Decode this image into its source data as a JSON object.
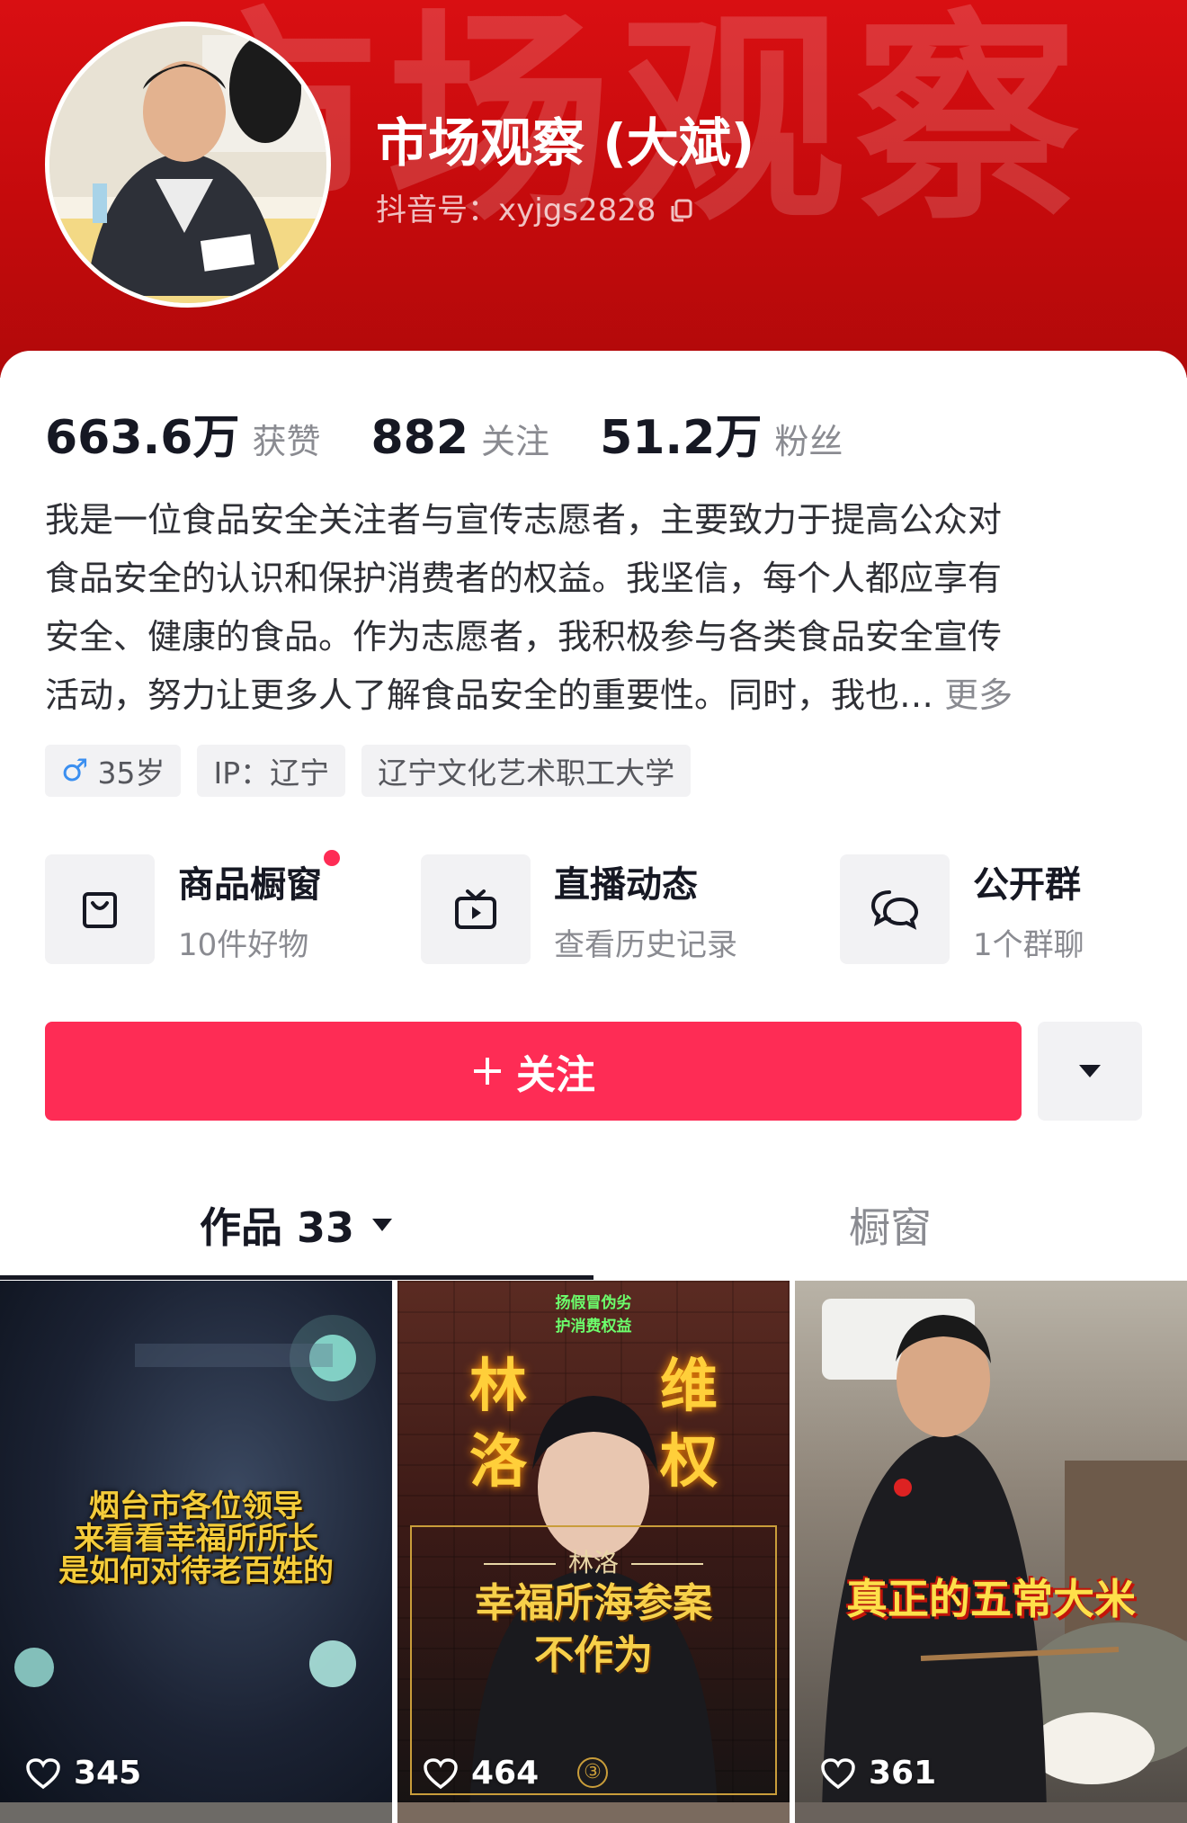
{
  "header": {
    "watermark_text": "市场观察",
    "display_name": "市场观察 (大斌)",
    "account_id_label": "抖音号：",
    "account_id": "xyjgs2828"
  },
  "stats": [
    {
      "value": "663.6万",
      "label": "获赞"
    },
    {
      "value": "882",
      "label": "关注"
    },
    {
      "value": "51.2万",
      "label": "粉丝"
    }
  ],
  "bio": {
    "lines": [
      "我是一位食品安全关注者与宣传志愿者，主要致力于提高公众对",
      "食品安全的认识和保护消费者的权益。我坚信，每个人都应享有",
      "安全、健康的食品。作为志愿者，我积极参与各类食品安全宣传",
      "活动，努力让更多人了解食品安全的重要性。同时，我也…"
    ],
    "more_label": "更多"
  },
  "tags": {
    "gender_symbol": "♂",
    "age": "35岁",
    "ip": "IP：辽宁",
    "school": "辽宁文化艺术职工大学"
  },
  "features": [
    {
      "icon": "shopping-bag-icon",
      "title": "商品橱窗",
      "subtitle": "10件好物",
      "has_dot": true
    },
    {
      "icon": "live-tv-icon",
      "title": "直播动态",
      "subtitle": "查看历史记录",
      "has_dot": false
    },
    {
      "icon": "group-chat-icon",
      "title": "公开群",
      "subtitle": "1个群聊",
      "has_dot": false
    }
  ],
  "actions": {
    "follow_label": "关注",
    "follow_icon": "plus-icon",
    "more_icon": "caret-down-icon"
  },
  "tabs": [
    {
      "label": "作品 33",
      "active": true
    },
    {
      "label": "橱窗",
      "active": false
    }
  ],
  "videos": [
    {
      "likes": "345",
      "caption_lines": [
        "烟台市各位领导",
        "来看看幸福所所长",
        "是如何对待老百姓的"
      ]
    },
    {
      "likes": "464",
      "top_text": [
        "扬假冒伪劣",
        "护消费权益"
      ],
      "big_chars": [
        "林",
        "洛",
        "维",
        "权"
      ],
      "name": "林洛",
      "caption_lines": [
        "幸福所海参案",
        "不作为"
      ],
      "badge": "③"
    },
    {
      "likes": "361",
      "caption_lines": [
        "真正的五常大米"
      ]
    }
  ],
  "colors": {
    "banner_red": "#d90f12",
    "follow_pink": "#fe2c55",
    "secondary_text": "#8a8b91"
  }
}
